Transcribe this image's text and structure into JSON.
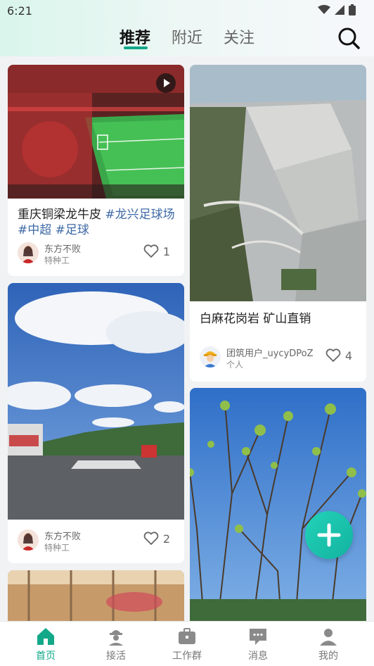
{
  "status_bar": {
    "time": "6:21"
  },
  "tabs": [
    {
      "label": "推荐",
      "active": true
    },
    {
      "label": "附近",
      "active": false
    },
    {
      "label": "关注",
      "active": false
    }
  ],
  "feed": {
    "left": [
      {
        "title": "重庆铜梁龙牛皮",
        "tags": [
          "#龙兴足球场",
          "#中超",
          "#足球"
        ],
        "author": "东方不败",
        "role": "特种工",
        "likes": "1",
        "is_video": true
      },
      {
        "author": "东方不败",
        "role": "特种工",
        "likes": "2"
      }
    ],
    "right": [
      {
        "title": "白麻花岗岩 矿山直销",
        "author": "团筑用户_uycyDPoZ",
        "role": "个人",
        "likes": "4"
      }
    ]
  },
  "bottom_nav": [
    {
      "label": "首页",
      "icon": "home-icon",
      "active": true
    },
    {
      "label": "接活",
      "icon": "worker-icon",
      "active": false
    },
    {
      "label": "工作群",
      "icon": "briefcase-icon",
      "active": false
    },
    {
      "label": "消息",
      "icon": "message-icon",
      "active": false
    },
    {
      "label": "我的",
      "icon": "profile-icon",
      "active": false
    }
  ],
  "colors": {
    "accent": "#12a888",
    "tag": "#3f6aa6",
    "fab": "#1ec8b0"
  }
}
